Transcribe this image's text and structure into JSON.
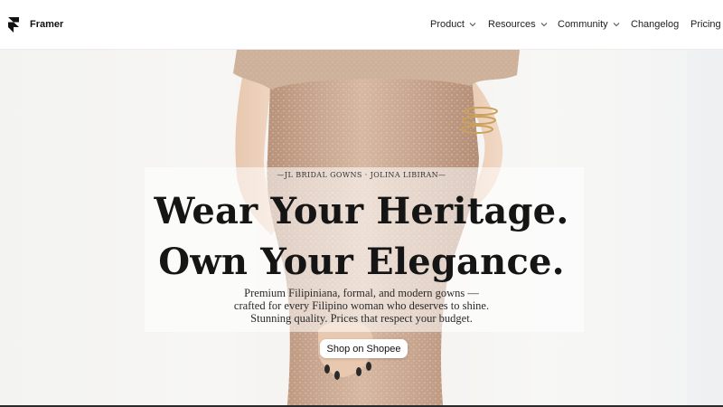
{
  "nav": {
    "brand": "Framer",
    "items": [
      {
        "label": "Product",
        "has_dropdown": true
      },
      {
        "label": "Resources",
        "has_dropdown": true
      },
      {
        "label": "Community",
        "has_dropdown": true
      },
      {
        "label": "Changelog",
        "has_dropdown": false
      },
      {
        "label": "Pricing",
        "has_dropdown": false
      }
    ]
  },
  "hero": {
    "eyebrow": "—JL BRIDAL GOWNS · JOLINA LIBIRAN—",
    "headline_line1": "Wear Your Heritage.",
    "headline_line2": "Own Your Elegance.",
    "subtext_line1": "Premium Filipiniana, formal, and modern gowns —",
    "subtext_line2": "crafted for every Filipino woman who deserves to shine.",
    "subtext_line3": "Stunning quality. Prices that respect your budget.",
    "cta_label": "Shop on Shopee"
  },
  "icons": {
    "brand": "framer-logo-icon",
    "dropdown": "chevron-down-icon"
  },
  "colors": {
    "text": "#151515",
    "gown_base": "#c9a48c",
    "fur_trim": "#cdb19a",
    "bracelet": "#c9a25a",
    "nail_polish": "#2a2a2a"
  }
}
